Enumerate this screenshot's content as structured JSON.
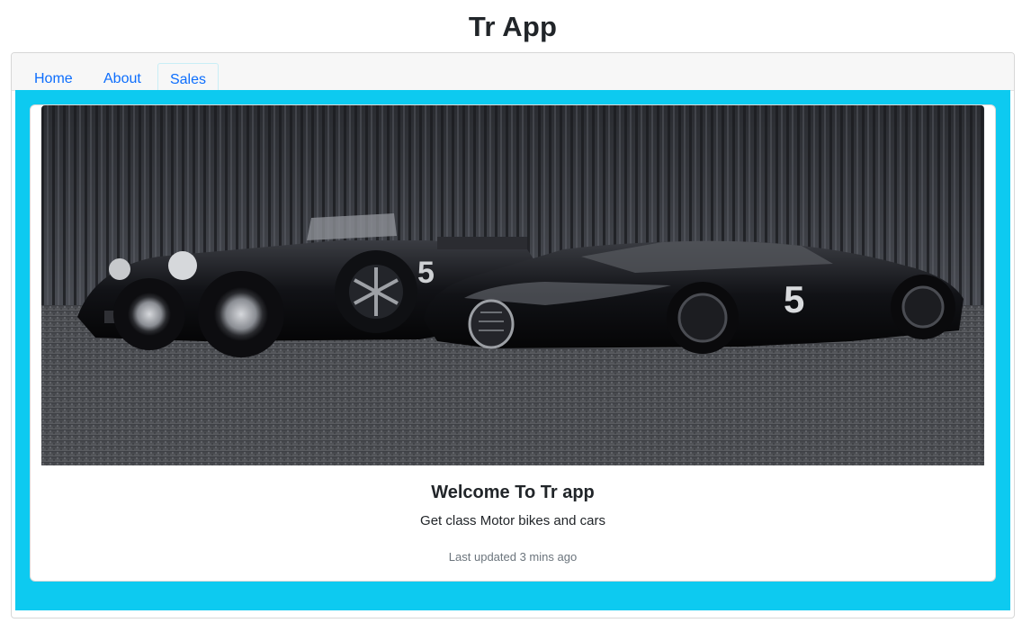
{
  "app": {
    "title": "Tr App"
  },
  "nav": {
    "tabs": [
      {
        "label": "Home"
      },
      {
        "label": "About"
      },
      {
        "label": "Sales"
      }
    ],
    "active_tab": "Sales",
    "link_color": "#0d6efd"
  },
  "panel": {
    "background_color": "#0dcaf0"
  },
  "card": {
    "image_alt": "Two black race cars numbered 5: vintage roadster and modern hypercar",
    "car_number": "5",
    "title": "Welcome To Tr app",
    "text": "Get class Motor bikes and cars",
    "footnote": "Last updated 3 mins ago"
  }
}
